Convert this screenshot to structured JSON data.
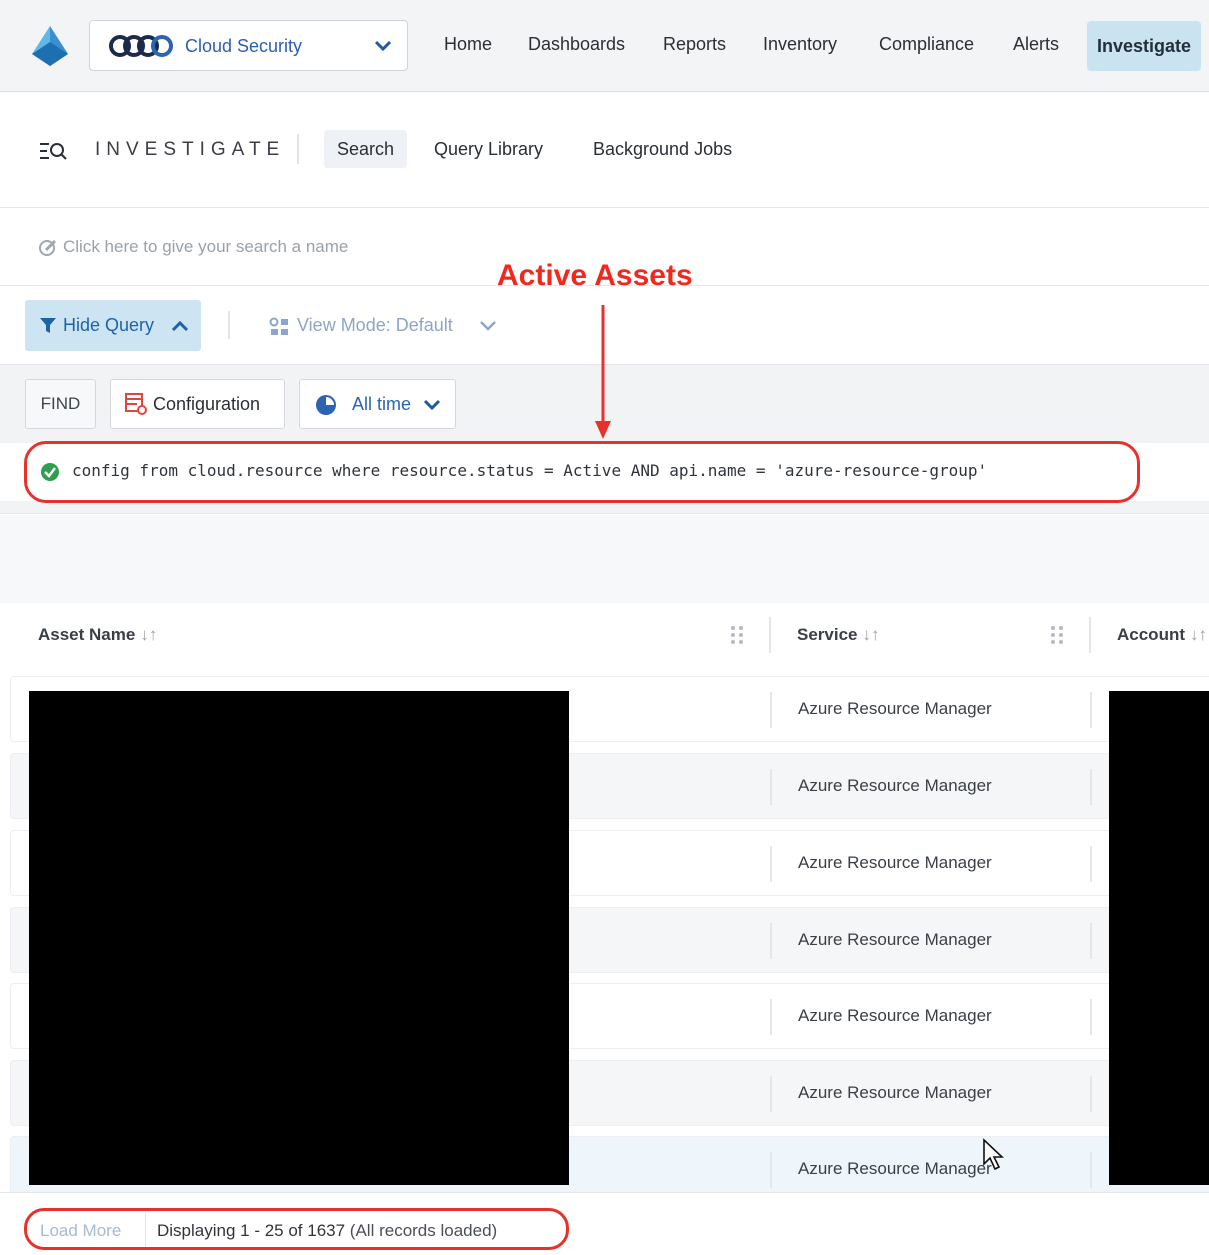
{
  "topnav": {
    "product": "Cloud Security",
    "items": [
      {
        "label": "Home"
      },
      {
        "label": "Dashboards"
      },
      {
        "label": "Reports"
      },
      {
        "label": "Inventory"
      },
      {
        "label": "Compliance"
      },
      {
        "label": "Alerts"
      },
      {
        "label": "Investigate",
        "active": true
      }
    ]
  },
  "investigate": {
    "title": "INVESTIGATE",
    "tabs": [
      {
        "label": "Search",
        "active": true
      },
      {
        "label": "Query Library"
      },
      {
        "label": "Background Jobs"
      }
    ]
  },
  "search_name": {
    "placeholder": "Click here to give your search a name"
  },
  "annotation": {
    "label": "Active Assets",
    "color": "#f0281e"
  },
  "toolbar": {
    "hide_query": "Hide Query",
    "view_mode": "View Mode: Default"
  },
  "query": {
    "find": "FIND",
    "configuration": "Configuration",
    "time_range": "All time",
    "text": "config from cloud.resource where resource.status = Active AND api.name = 'azure-resource-group'",
    "status": "valid"
  },
  "table": {
    "columns": [
      {
        "label": "Asset Name"
      },
      {
        "label": "Service"
      },
      {
        "label": "Account"
      }
    ],
    "rows": [
      {
        "service": "Azure Resource Manager"
      },
      {
        "service": "Azure Resource Manager"
      },
      {
        "service": "Azure Resource Manager"
      },
      {
        "service": "Azure Resource Manager"
      },
      {
        "service": "Azure Resource Manager"
      },
      {
        "service": "Azure Resource Manager"
      },
      {
        "service": "Azure Resource Manager"
      }
    ]
  },
  "footer": {
    "load_more": "Load More",
    "display": "Displaying 1 - 25 of 1637",
    "loaded": "(All records loaded)"
  },
  "colors": {
    "accent": "#2b64b3",
    "active_nav_bg": "#c9e3f0",
    "highlight": "#e8312b",
    "ok": "#2e9e4f"
  }
}
